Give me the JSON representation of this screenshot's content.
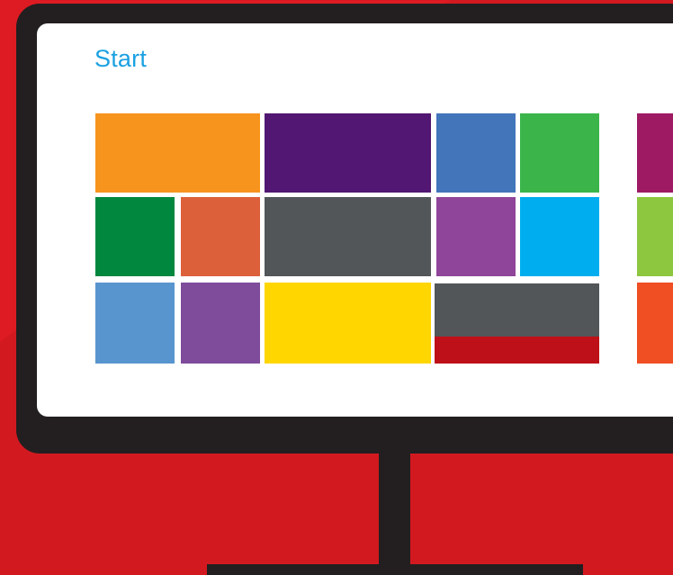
{
  "start_screen": {
    "title": "Start"
  },
  "tiles": [
    {
      "name": "tile-orange-wide",
      "color": "#f7941d"
    },
    {
      "name": "tile-purple-wide",
      "color": "#511772"
    },
    {
      "name": "tile-blue",
      "color": "#4375bb"
    },
    {
      "name": "tile-green",
      "color": "#3bb54a"
    },
    {
      "name": "tile-magenta-partial",
      "color": "#9e1a63"
    },
    {
      "name": "tile-dark-green",
      "color": "#02873e"
    },
    {
      "name": "tile-coral",
      "color": "#dc603a"
    },
    {
      "name": "tile-gray-wide",
      "color": "#525659"
    },
    {
      "name": "tile-violet",
      "color": "#8f4599"
    },
    {
      "name": "tile-cyan",
      "color": "#00aeef"
    },
    {
      "name": "tile-lime-partial",
      "color": "#8dc63f"
    },
    {
      "name": "tile-light-blue",
      "color": "#5895ce"
    },
    {
      "name": "tile-lavender",
      "color": "#7f4b9b"
    },
    {
      "name": "tile-yellow-wide",
      "color": "#ffd600"
    },
    {
      "name": "tile-gray-red-wide",
      "color": "#525659",
      "accent": "#be1018"
    },
    {
      "name": "tile-red-orange-partial",
      "color": "#f04e23"
    }
  ]
}
